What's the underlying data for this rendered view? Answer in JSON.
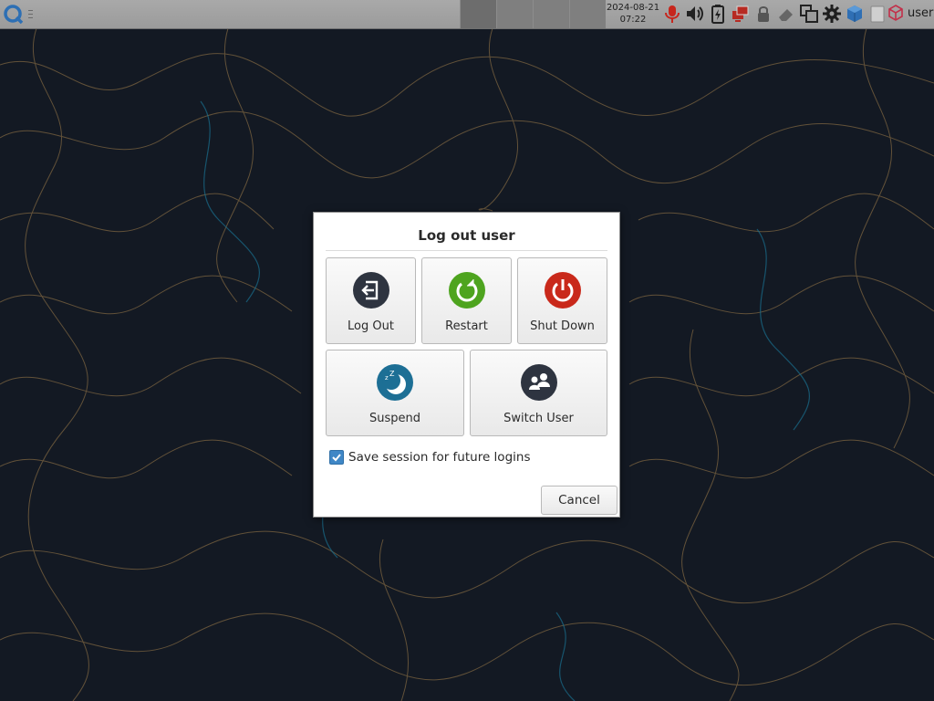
{
  "panel": {
    "clock_date": "2024-08-21",
    "clock_time": "07:22",
    "user_label": "user",
    "tray_icons": [
      "microphone-icon",
      "volume-icon",
      "battery-icon",
      "network-icon",
      "lock-icon",
      "eraser-icon",
      "window-switch-icon",
      "settings-gear-icon",
      "package-cube-icon",
      "blank-tray-icon"
    ]
  },
  "dialog": {
    "title": "Log out user",
    "buttons": {
      "logout": "Log Out",
      "restart": "Restart",
      "shutdown": "Shut Down",
      "suspend": "Suspend",
      "switch_user": "Switch User"
    },
    "save_session_label": "Save session for future logins",
    "save_session_checked": true,
    "cancel_label": "Cancel"
  },
  "colors": {
    "logout_icon": "#2e3440",
    "restart_icon": "#4ea41f",
    "shutdown_icon": "#c9291b",
    "suspend_icon": "#1d6f95",
    "switch_icon": "#2e3440",
    "checkbox": "#3f87c6"
  }
}
